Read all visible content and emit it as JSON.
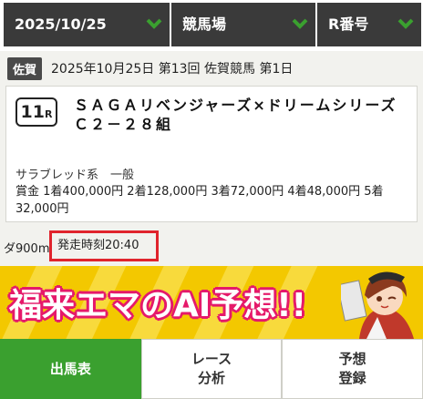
{
  "selectors": {
    "date": "2025/10/25",
    "venue": "競馬場",
    "race_number": "R番号"
  },
  "race_header": {
    "badge": "佐賀",
    "text": "2025年10月25日 第13回 佐賀競馬 第1日"
  },
  "race": {
    "number": "11",
    "number_suffix": "R",
    "name": "ＳＡＧＡリベンジャーズ×ドリームシリーズ　Ｃ２－２８組",
    "category": "サラブレッド系　一般",
    "prize": "賞金 1着400,000円 2着128,000円 3着72,000円 4着48,000円 5着32,000円",
    "course": "ダ900m",
    "start_time": "発走時刻20:40"
  },
  "banner": {
    "title": "福来エマのAI予想!!"
  },
  "tabs": [
    {
      "label": "出馬表",
      "active": true
    },
    {
      "label": "レース\n分析",
      "active": false
    },
    {
      "label": "予想\n登録",
      "active": false
    }
  ],
  "colors": {
    "selector_bg": "#3a3a3a",
    "chevron": "#3aa02f",
    "active_tab": "#3aa02f",
    "banner_bg": "#f3c800",
    "banner_text_outline": "#e5196a",
    "highlight_border": "#e0242c"
  }
}
